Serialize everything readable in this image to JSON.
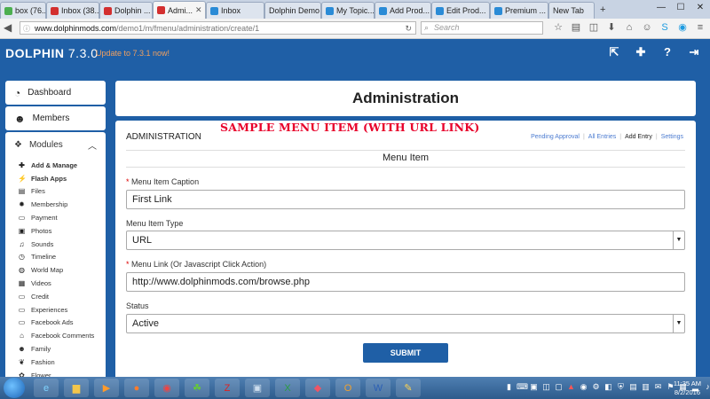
{
  "browser": {
    "tabs": [
      {
        "label": "box (76...",
        "color": "#4caf50",
        "icon": "notification-icon",
        "active": false
      },
      {
        "label": "Inbox (38...",
        "color": "#d32f2f",
        "icon": "gmail-icon",
        "active": false
      },
      {
        "label": "Dolphin ...",
        "color": "#d32f2f",
        "icon": "dolphin-icon",
        "active": false
      },
      {
        "label": "Admi...",
        "color": "#d32f2f",
        "icon": "dolphin-icon",
        "active": true
      },
      {
        "label": "Inbox",
        "color": "#2a8bd6",
        "icon": "link-icon",
        "active": false
      },
      {
        "label": "Dolphin Demo",
        "color": "",
        "icon": "",
        "active": false
      },
      {
        "label": "My Topic...",
        "color": "#2a8bd6",
        "icon": "link-icon",
        "active": false
      },
      {
        "label": "Add Prod...",
        "color": "#2a8bd6",
        "icon": "link-icon",
        "active": false
      },
      {
        "label": "Edit Prod...",
        "color": "#2a8bd6",
        "icon": "link-icon",
        "active": false
      },
      {
        "label": "Premium ...",
        "color": "#2a8bd6",
        "icon": "link-icon",
        "active": false
      },
      {
        "label": "New Tab",
        "color": "",
        "icon": "",
        "active": false
      }
    ],
    "url_host": "www.dolphinmods.com",
    "url_path": "/demo1/m/fmenu/administration/create/1",
    "search_placeholder": "Search"
  },
  "header": {
    "logo": "DOLPHIN",
    "version": "7.3.0",
    "update_text": "Update to 7.3.1 now!"
  },
  "sidebar": {
    "dashboard": "Dashboard",
    "members": "Members",
    "modules": "Modules",
    "module_items": [
      {
        "label": "Add & Manage",
        "icon": "plus-icon",
        "glyph": "✚",
        "bold": true
      },
      {
        "label": "Flash Apps",
        "icon": "flash-icon",
        "glyph": "⚡",
        "bold": true
      },
      {
        "label": "Files",
        "icon": "file-icon",
        "glyph": "▤",
        "bold": false
      },
      {
        "label": "Membership",
        "icon": "membership-icon",
        "glyph": "✹",
        "bold": false
      },
      {
        "label": "Payment",
        "icon": "payment-icon",
        "glyph": "▭",
        "bold": false
      },
      {
        "label": "Photos",
        "icon": "photos-icon",
        "glyph": "▣",
        "bold": false
      },
      {
        "label": "Sounds",
        "icon": "music-icon",
        "glyph": "♫",
        "bold": false
      },
      {
        "label": "Timeline",
        "icon": "clock-icon",
        "glyph": "◷",
        "bold": false
      },
      {
        "label": "World Map",
        "icon": "globe-icon",
        "glyph": "◍",
        "bold": false
      },
      {
        "label": "Videos",
        "icon": "film-icon",
        "glyph": "▦",
        "bold": false
      },
      {
        "label": "Credit",
        "icon": "money-icon",
        "glyph": "▭",
        "bold": false
      },
      {
        "label": "Experiences",
        "icon": "money-icon",
        "glyph": "▭",
        "bold": false
      },
      {
        "label": "Facebook Ads",
        "icon": "money-icon",
        "glyph": "▭",
        "bold": false
      },
      {
        "label": "Facebook Comments",
        "icon": "home-icon",
        "glyph": "⌂",
        "bold": false
      },
      {
        "label": "Family",
        "icon": "users-icon",
        "glyph": "☻",
        "bold": false
      },
      {
        "label": "Fashion",
        "icon": "leaf-icon",
        "glyph": "❦",
        "bold": false
      },
      {
        "label": "Flower",
        "icon": "flower-icon",
        "glyph": "✿",
        "bold": false
      }
    ]
  },
  "page": {
    "title": "Administration",
    "overlay_text": "SAMPLE MENU ITEM (WITH URL LINK)",
    "section_label": "ADMINISTRATION",
    "tabs": [
      "Pending Approval",
      "All Entries",
      "Add Entry",
      "Settings"
    ],
    "form_title": "Menu Item",
    "fields": {
      "caption_label": "Menu Item Caption",
      "caption_value": "First Link",
      "type_label": "Menu Item Type",
      "type_value": "URL",
      "link_label": "Menu Link (Or Javascript Click Action)",
      "link_value": "http://www.dolphinmods.com/browse.php",
      "status_label": "Status",
      "status_value": "Active"
    },
    "submit_label": "SUBMIT"
  },
  "taskbar": {
    "time": "11:35 AM",
    "date": "8/2/2016"
  }
}
